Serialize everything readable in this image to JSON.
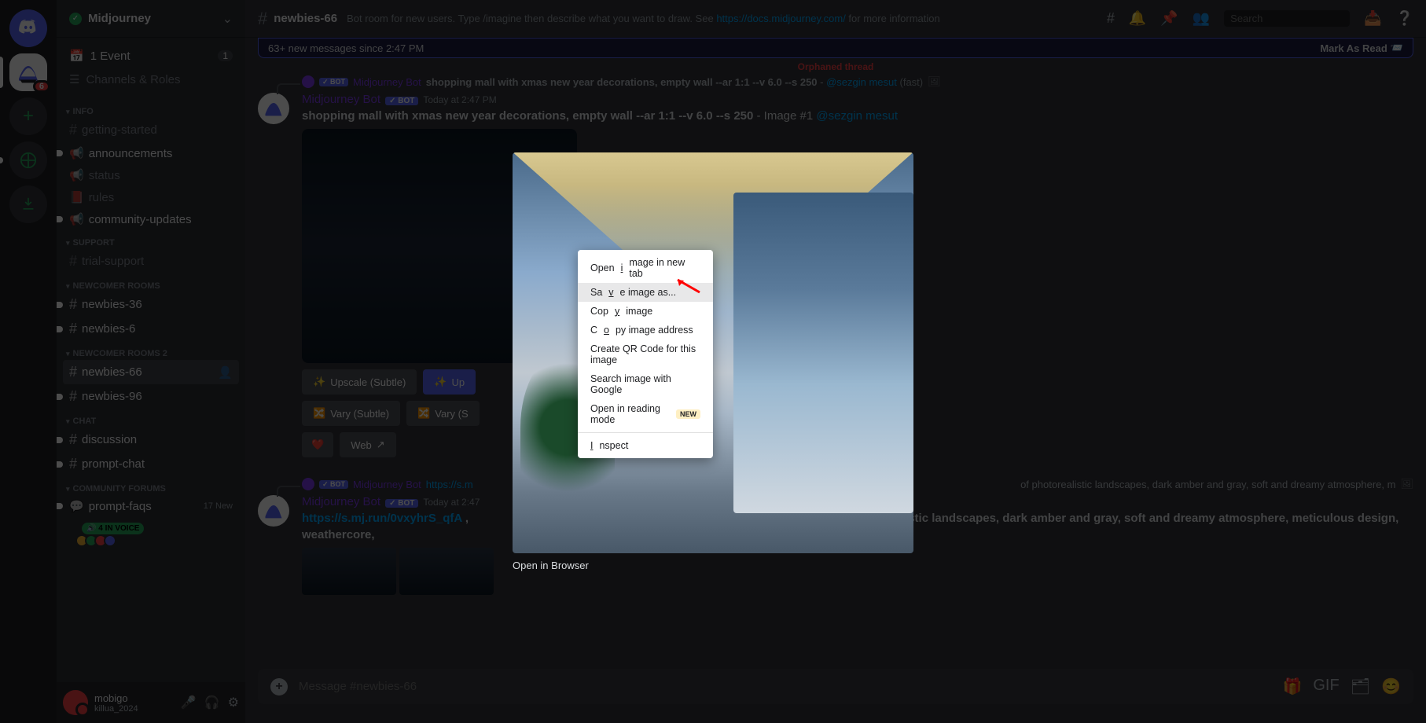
{
  "server": {
    "name": "Midjourney"
  },
  "sidebar": {
    "event": {
      "label": "1 Event",
      "count": "1"
    },
    "browse": "Channels & Roles",
    "cats": [
      {
        "name": "INFO",
        "channels": [
          {
            "label": "getting-started",
            "type": "hash"
          },
          {
            "label": "announcements",
            "type": "mega",
            "unread": true
          },
          {
            "label": "status",
            "type": "mega"
          },
          {
            "label": "rules",
            "type": "book"
          },
          {
            "label": "community-updates",
            "type": "mega",
            "unread": true
          }
        ]
      },
      {
        "name": "SUPPORT",
        "channels": [
          {
            "label": "trial-support",
            "type": "hash"
          }
        ]
      },
      {
        "name": "NEWCOMER ROOMS",
        "channels": [
          {
            "label": "newbies-36",
            "type": "hash",
            "unread": true
          },
          {
            "label": "newbies-6",
            "type": "hash",
            "unread": true
          }
        ]
      },
      {
        "name": "NEWCOMER ROOMS 2",
        "channels": [
          {
            "label": "newbies-66",
            "type": "hash",
            "active": true
          },
          {
            "label": "newbies-96",
            "type": "hash",
            "unread": true
          }
        ]
      },
      {
        "name": "CHAT",
        "channels": [
          {
            "label": "discussion",
            "type": "hash",
            "unread": true
          },
          {
            "label": "prompt-chat",
            "type": "hash",
            "unread": true
          }
        ]
      },
      {
        "name": "COMMUNITY FORUMS",
        "channels": [
          {
            "label": "prompt-faqs",
            "type": "forum",
            "unread": true,
            "right": "17 New"
          }
        ]
      }
    ],
    "voice_label": "4 IN VOICE"
  },
  "user": {
    "name": "mobigo",
    "tag": "killua_2024"
  },
  "topbar": {
    "channel": "newbies-66",
    "topic_pre": "Bot room for new users. Type /imagine then describe what you want to draw. See ",
    "topic_link": "https://docs.midjourney.com/",
    "topic_post": " for more information",
    "search_placeholder": "Search"
  },
  "newmsg": {
    "text": "63+ new messages since 2:47 PM",
    "mark": "Mark As Read"
  },
  "orphan": "Orphaned thread",
  "reply1": {
    "bot": "✓ BOT",
    "author": "Midjourney Bot",
    "text": "shopping mall with xmas new year decorations, empty wall --ar 1:1 --v 6.0 --s 250",
    "mention": "@sezgin mesut",
    "fast": "(fast)"
  },
  "msg1": {
    "author": "Midjourney Bot",
    "bot": "✓ BOT",
    "time": "Today at 2:47 PM",
    "body": "shopping mall with xmas new year decorations, empty wall --ar 1:1 --v 6.0 --s 250",
    "suffix": " - Image #1 ",
    "mention": "@sezgin mesut"
  },
  "buttons": {
    "upscale_subtle": "Upscale (Subtle)",
    "upscale_strong": "Up",
    "vary_subtle": "Vary (Subtle)",
    "vary_strong": "Vary (S",
    "web": "Web"
  },
  "reply2": {
    "bot": "✓ BOT",
    "author": "Midjourney Bot",
    "link": "https://s.m",
    "tail": " of photorealistic landscapes, dark amber and gray, soft and dreamy atmosphere, m"
  },
  "msg2": {
    "author": "Midjourney Bot",
    "bot": "✓ BOT",
    "time": "Today at 2:47",
    "link": "https://s.mj.run/0vxyhrS_qfA",
    "body": " ,",
    "tail": "realistic landscapes, dark amber and gray, soft and dreamy atmosphere, meticulous design, weathercore,"
  },
  "input": {
    "placeholder": "Message #newbies-66"
  },
  "overlay": {
    "open_browser": "Open in Browser"
  },
  "ctx": {
    "open_tab": "Open image in new tab",
    "save_as": "Save image as...",
    "copy_img": "Copy image",
    "copy_addr": "Copy image address",
    "qr": "Create QR Code for this image",
    "search": "Search image with Google",
    "reading": "Open in reading mode",
    "new": "NEW",
    "inspect": "Inspect"
  }
}
